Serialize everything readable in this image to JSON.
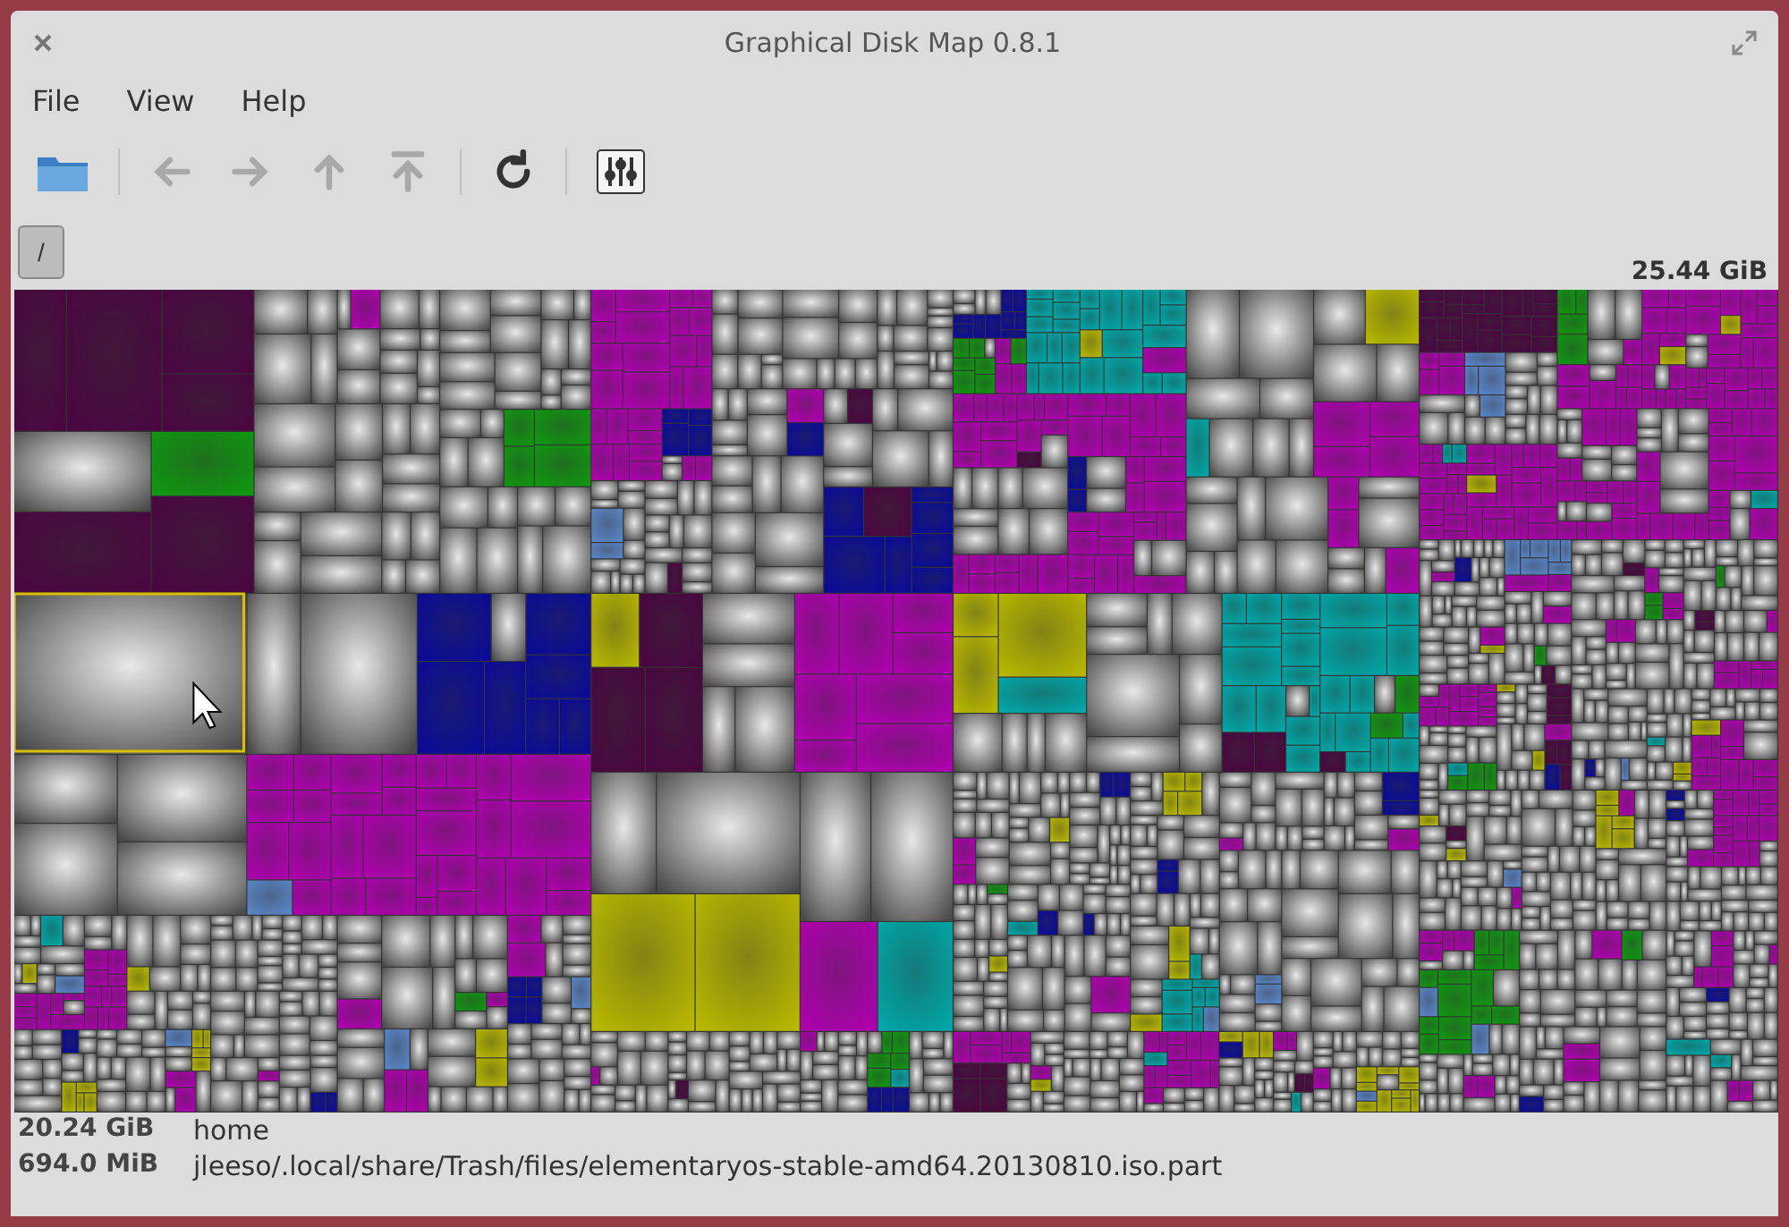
{
  "window": {
    "title": "Graphical Disk Map 0.8.1"
  },
  "menu": [
    {
      "label": "File"
    },
    {
      "label": "View"
    },
    {
      "label": "Help"
    }
  ],
  "toolbar": [
    {
      "kind": "open",
      "disabled": false
    },
    {
      "kind": "separator"
    },
    {
      "kind": "back",
      "disabled": true
    },
    {
      "kind": "forward",
      "disabled": true
    },
    {
      "kind": "up",
      "disabled": true
    },
    {
      "kind": "top",
      "disabled": true
    },
    {
      "kind": "separator"
    },
    {
      "kind": "refresh",
      "disabled": false
    },
    {
      "kind": "separator"
    },
    {
      "kind": "settings",
      "disabled": false
    }
  ],
  "breadcrumb": [
    {
      "label": "/"
    }
  ],
  "total_size": "25.44 GiB",
  "status": [
    {
      "size": "20.24 GiB",
      "path": "home"
    },
    {
      "size": "694.0 MiB",
      "path": "jleeso/.local/share/Trash/files/elementaryos-stable-amd64.20130810.iso.part"
    }
  ]
}
